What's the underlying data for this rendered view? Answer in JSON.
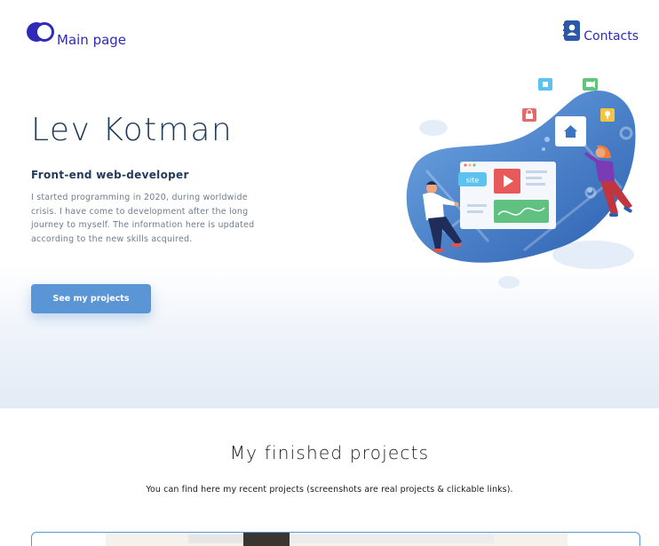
{
  "header": {
    "logo_label": "Main page",
    "contacts_label": "Contacts"
  },
  "hero": {
    "name": "Lev Kotman",
    "role": "Front-end web-developer",
    "about": "I started programming in 2020, during worldwide crisis. I have come to development after the long journey to myself. The information here is updated according to the new skills acquired.",
    "cta_label": "See my projects",
    "illustration": {
      "site_tag": "site"
    }
  },
  "projects": {
    "title": "My finished projects",
    "subtitle": "You can find here my recent projects (screenshots are real projects & clickable links)."
  },
  "colors": {
    "brand": "#2d2bb8",
    "accent": "#5a95d6",
    "heading": "#1f3a5a",
    "muted_text": "#6f7d8e"
  },
  "icons": [
    "logo-icon",
    "contact-book-icon",
    "home-icon",
    "play-icon",
    "lock-icon",
    "bulb-icon",
    "video-icon",
    "puzzle-icon"
  ]
}
